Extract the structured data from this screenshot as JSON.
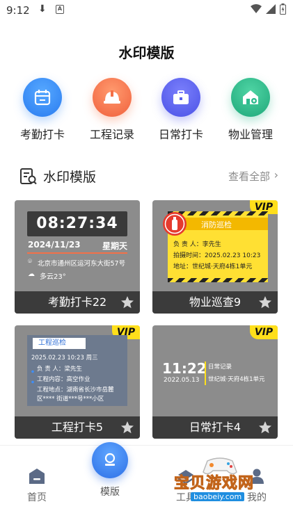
{
  "status": {
    "time": "9:12",
    "a_label": "A"
  },
  "page": {
    "title": "水印模版"
  },
  "categories": [
    {
      "label": "考勤打卡",
      "icon": "calendar-icon",
      "color": "#3e8ef7"
    },
    {
      "label": "工程记录",
      "icon": "hardhat-icon",
      "color": "#f6774e"
    },
    {
      "label": "日常打卡",
      "icon": "briefcase-icon",
      "color": "#5860ee"
    },
    {
      "label": "物业管理",
      "icon": "house-gear-icon",
      "color": "#2dbb8e"
    }
  ],
  "section": {
    "title": "水印模版",
    "more": "查看全部"
  },
  "cards": [
    {
      "name": "考勤打卡22",
      "time": "08:27:34",
      "date": "2024/11/23",
      "weekday": "星期天",
      "address": "北京市通州区运河东大街57号",
      "weather": "多云23°"
    },
    {
      "name": "物业巡查9",
      "vip": "VIP",
      "header": "消防巡检",
      "l1": "负 责 人：李先生",
      "l2": "拍摄时间：2025.02.23  10:23",
      "l3": "地址：世纪城·天府4栋1单元"
    },
    {
      "name": "工程打卡5",
      "vip": "VIP",
      "header": "工程巡检",
      "l1": "2025.02.23  10:23  周三",
      "l2": "负 责 人：梁先生",
      "l3": "工程内容：高空作业",
      "l4": "工程地点：湖南省长沙市岳麓",
      "l5": "区**** 街道***号***小区"
    },
    {
      "name": "日常打卡4",
      "vip": "VIP",
      "time": "11:22",
      "date": "2022.05.13",
      "l1": "日常记录",
      "l2": "世纪城·天府4栋1单元"
    }
  ],
  "nav": {
    "home": "首页",
    "template": "模版",
    "tools": "工具",
    "mine": "我的"
  },
  "watermark": {
    "text": "宝贝游戏网",
    "url": "baobeiy.com"
  }
}
